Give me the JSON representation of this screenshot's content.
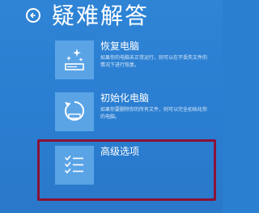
{
  "header": {
    "title": "疑难解答",
    "back_icon": "back-arrow-icon"
  },
  "options": [
    {
      "title": "恢复电脑",
      "description": "如果你的电脑未正常运行，则可以在不丢失文件的情况下进行恢复。",
      "icon": "refresh-sparkle-icon"
    },
    {
      "title": "初始化电脑",
      "description": "如果你要删除你的所有文件，则可以完全初始化你的电脑。",
      "icon": "reset-cycle-icon"
    },
    {
      "title": "高级选项",
      "description": "",
      "icon": "checklist-icon"
    }
  ],
  "colors": {
    "background": "#2b7fd0",
    "tile": "#5aa4e6",
    "highlight_border": "#8b1236"
  }
}
